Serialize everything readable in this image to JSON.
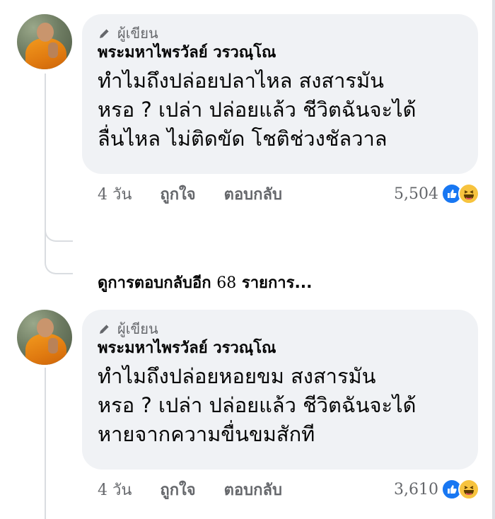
{
  "comments": [
    {
      "author_badge": "ผู้เขียน",
      "author_name": "พระมหาไพรวัลย์ วรวณฺโณ",
      "lines": [
        "ทำไมถึงปล่อยปลาไหล สงสารมัน",
        "หรอ ? เปล่า ปล่อยแล้ว ชีวิตฉันจะได้",
        "ลื่นไหล ไม่ติดขัด โชติช่วงชัลวาล"
      ],
      "time": "4 วัน",
      "like_label": "ถูกใจ",
      "reply_label": "ตอบกลับ",
      "reaction_count": "5,504"
    },
    {
      "author_badge": "ผู้เขียน",
      "author_name": "พระมหาไพรวัลย์ วรวณฺโณ",
      "lines": [
        "ทำไมถึงปล่อยหอยขม สงสารมัน",
        "หรอ ? เปล่า ปล่อยแล้ว ชีวิตฉันจะได้",
        "หายจากความขื่นขมสักที"
      ],
      "time": "4 วัน",
      "like_label": "ถูกใจ",
      "reply_label": "ตอบกลับ",
      "reaction_count": "3,610"
    }
  ],
  "more_replies": {
    "prefix": "ดูการตอบกลับอีก",
    "count": "68",
    "suffix": "รายการ..."
  },
  "icons": {
    "author": "pen-icon",
    "reaction_1": "like-icon",
    "reaction_2": "haha-icon"
  },
  "colors": {
    "bubble_bg": "#f0f2f5",
    "like_blue": "#1877f2",
    "haha_yellow": "#f7c33e",
    "meta_gray": "#65676b"
  }
}
